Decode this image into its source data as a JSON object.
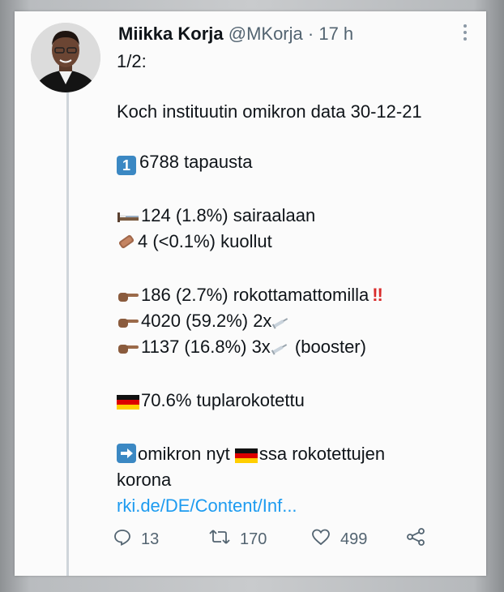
{
  "tweet": {
    "author_name": "Miikka Korja",
    "handle": "@MKorja",
    "separator": "·",
    "time": "17 h",
    "lines": {
      "l1": "1/2:",
      "l2": "Koch instituutin omikron data 30-12-21",
      "l3_badge": "1",
      "l3": "6788 tapausta",
      "l4": "124 (1.8%) sairaalaan",
      "l5": "4 (<0.1%) kuollut",
      "l6": "186 (2.7%) rokottamattomilla",
      "l6_mark": "!!",
      "l7": "4020 (59.2%) 2x",
      "l8a": "1137 (16.8%) 3x",
      "l8b": " (booster)",
      "l9": "70.6% tuplarokotettu",
      "l10a": "omikron nyt",
      "l10b": "ssa rokotettujen",
      "l11": "korona",
      "link": "rki.de/DE/Content/Inf..."
    },
    "actions": {
      "replies": "13",
      "retweets": "170",
      "likes": "499"
    },
    "icons": {
      "reply": "reply-icon",
      "retweet": "retweet-icon",
      "like": "heart-icon",
      "share": "share-icon",
      "more": "more-icon"
    },
    "colors": {
      "link": "#1d9bf0",
      "text": "#0f1419",
      "muted": "#536471"
    }
  }
}
